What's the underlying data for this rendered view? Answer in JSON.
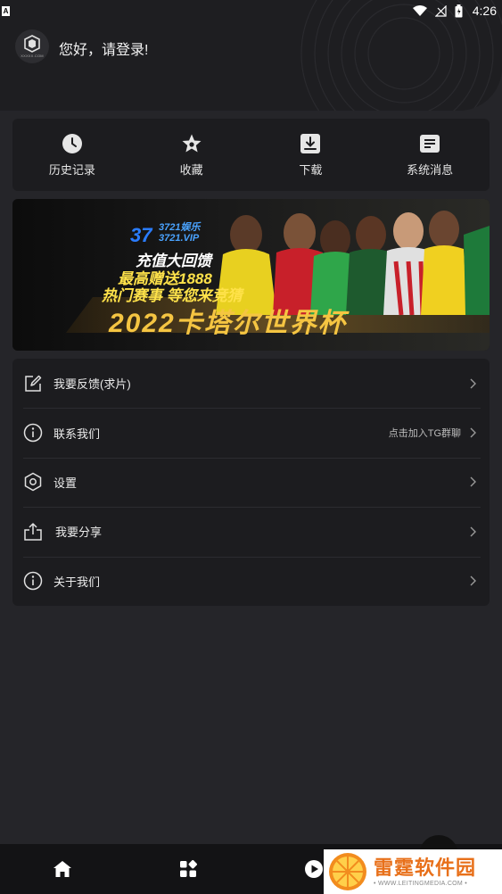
{
  "status_bar": {
    "notif_badge": "A",
    "time": "4:26"
  },
  "header": {
    "greeting": "您好，请登录!",
    "avatar_domain": "XXXXX.COM"
  },
  "quick_menu": [
    {
      "label": "历史记录",
      "icon": "clock-icon"
    },
    {
      "label": "收藏",
      "icon": "star-icon"
    },
    {
      "label": "下载",
      "icon": "download-icon"
    },
    {
      "label": "系统消息",
      "icon": "message-icon"
    }
  ],
  "banner": {
    "brand_number": "37",
    "brand_name": "3721娱乐",
    "brand_site": "3721.VIP",
    "line1": "充值大回馈",
    "line2": "最高赠送1888",
    "line3": "热门赛事 等您来竞猜",
    "headline": "2022卡塔尔世界杯"
  },
  "menu": [
    {
      "label": "我要反馈(求片)",
      "icon": "edit-icon",
      "hint": ""
    },
    {
      "label": "联系我们",
      "icon": "info-icon",
      "hint": "点击加入TG群聊"
    },
    {
      "label": "设置",
      "icon": "hexagon-settings-icon",
      "hint": ""
    },
    {
      "label": "我要分享",
      "icon": "share-icon",
      "hint": ""
    },
    {
      "label": "关于我们",
      "icon": "info-icon",
      "hint": ""
    }
  ],
  "bottom_nav": [
    {
      "icon": "home-icon"
    },
    {
      "icon": "apps-icon"
    },
    {
      "icon": "play-icon"
    },
    {
      "icon": "profile-icon"
    }
  ],
  "watermark": {
    "title": "雷霆软件园",
    "url": "• WWW.LEITINGMEDIA.COM •"
  },
  "colors": {
    "background": "#252529",
    "card": "#1c1c1f",
    "header": "#1e1e21",
    "banner_gold": "#f5c542",
    "watermark_orange": "#e8701a"
  }
}
